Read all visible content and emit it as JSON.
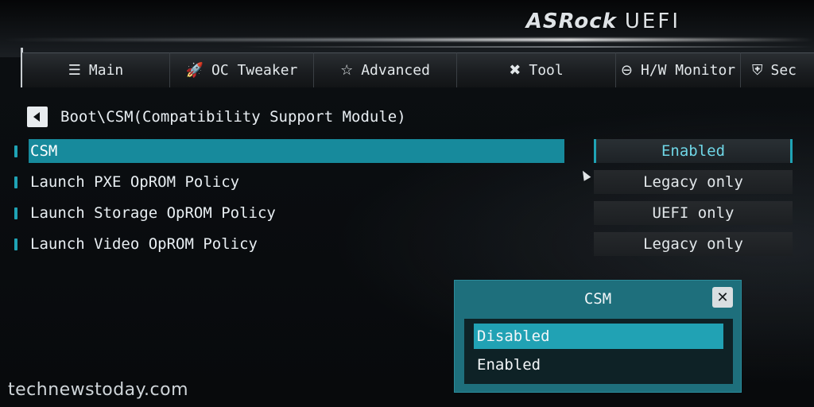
{
  "brand": {
    "name": "ASRock",
    "suffix": "UEFI"
  },
  "tabs": [
    {
      "label": "Main",
      "icon": "list-icon"
    },
    {
      "label": "OC Tweaker",
      "icon": "rocket-icon"
    },
    {
      "label": "Advanced",
      "icon": "star-icon"
    },
    {
      "label": "Tool",
      "icon": "wrench-icon"
    },
    {
      "label": "H/W Monitor",
      "icon": "gauge-icon"
    },
    {
      "label": "Sec",
      "icon": "shield-icon"
    }
  ],
  "breadcrumb": {
    "text": "Boot\\CSM(Compatibility Support Module)"
  },
  "settings": [
    {
      "label": "CSM",
      "value": "Enabled"
    },
    {
      "label": "Launch PXE OpROM Policy",
      "value": "Legacy only"
    },
    {
      "label": "Launch Storage OpROM Policy",
      "value": "UEFI only"
    },
    {
      "label": "Launch Video OpROM Policy",
      "value": "Legacy only"
    }
  ],
  "dialog": {
    "title": "CSM",
    "close_glyph": "✕",
    "options": [
      "Disabled",
      "Enabled"
    ],
    "selected_option": "Disabled"
  },
  "watermark": "technewstoday.com",
  "colors": {
    "accent": "#1fa3b5",
    "selection": "#178a9c",
    "dialog": "#1e6f7c"
  }
}
